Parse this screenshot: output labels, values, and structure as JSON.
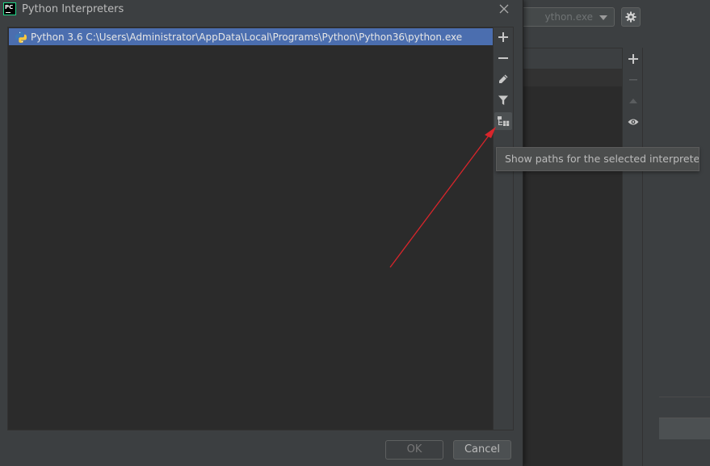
{
  "dialog": {
    "title": "Python Interpreters",
    "app_logo_text": "PC",
    "close_icon": "close-icon"
  },
  "interpreter_list": {
    "items": [
      {
        "label": "Python 3.6 C:\\Users\\Administrator\\AppData\\Local\\Programs\\Python\\Python36\\python.exe",
        "icon": "python-icon",
        "selected": true
      }
    ]
  },
  "toolbar": {
    "buttons": [
      {
        "name": "add",
        "icon": "plus-icon"
      },
      {
        "name": "remove",
        "icon": "minus-icon"
      },
      {
        "name": "edit",
        "icon": "pencil-icon"
      },
      {
        "name": "filter",
        "icon": "filter-icon"
      },
      {
        "name": "show-paths",
        "icon": "tree-paths-icon"
      }
    ]
  },
  "tooltip": {
    "text": "Show paths for the selected interpreter"
  },
  "footer": {
    "ok_label": "OK",
    "cancel_label": "Cancel"
  },
  "background_window": {
    "interpreter_combo_value": "ython.exe",
    "settings_icon": "gear-icon",
    "table_toolbar_icons": [
      "plus-icon",
      "minus-icon",
      "up-arrow-icon",
      "eye-icon"
    ]
  },
  "colors": {
    "dialog_bg": "#3c3f41",
    "list_bg": "#2b2b2b",
    "selection": "#4b6eaf",
    "annotation_arrow": "#d9252b",
    "tooltip_bg": "#4b4d4d"
  }
}
